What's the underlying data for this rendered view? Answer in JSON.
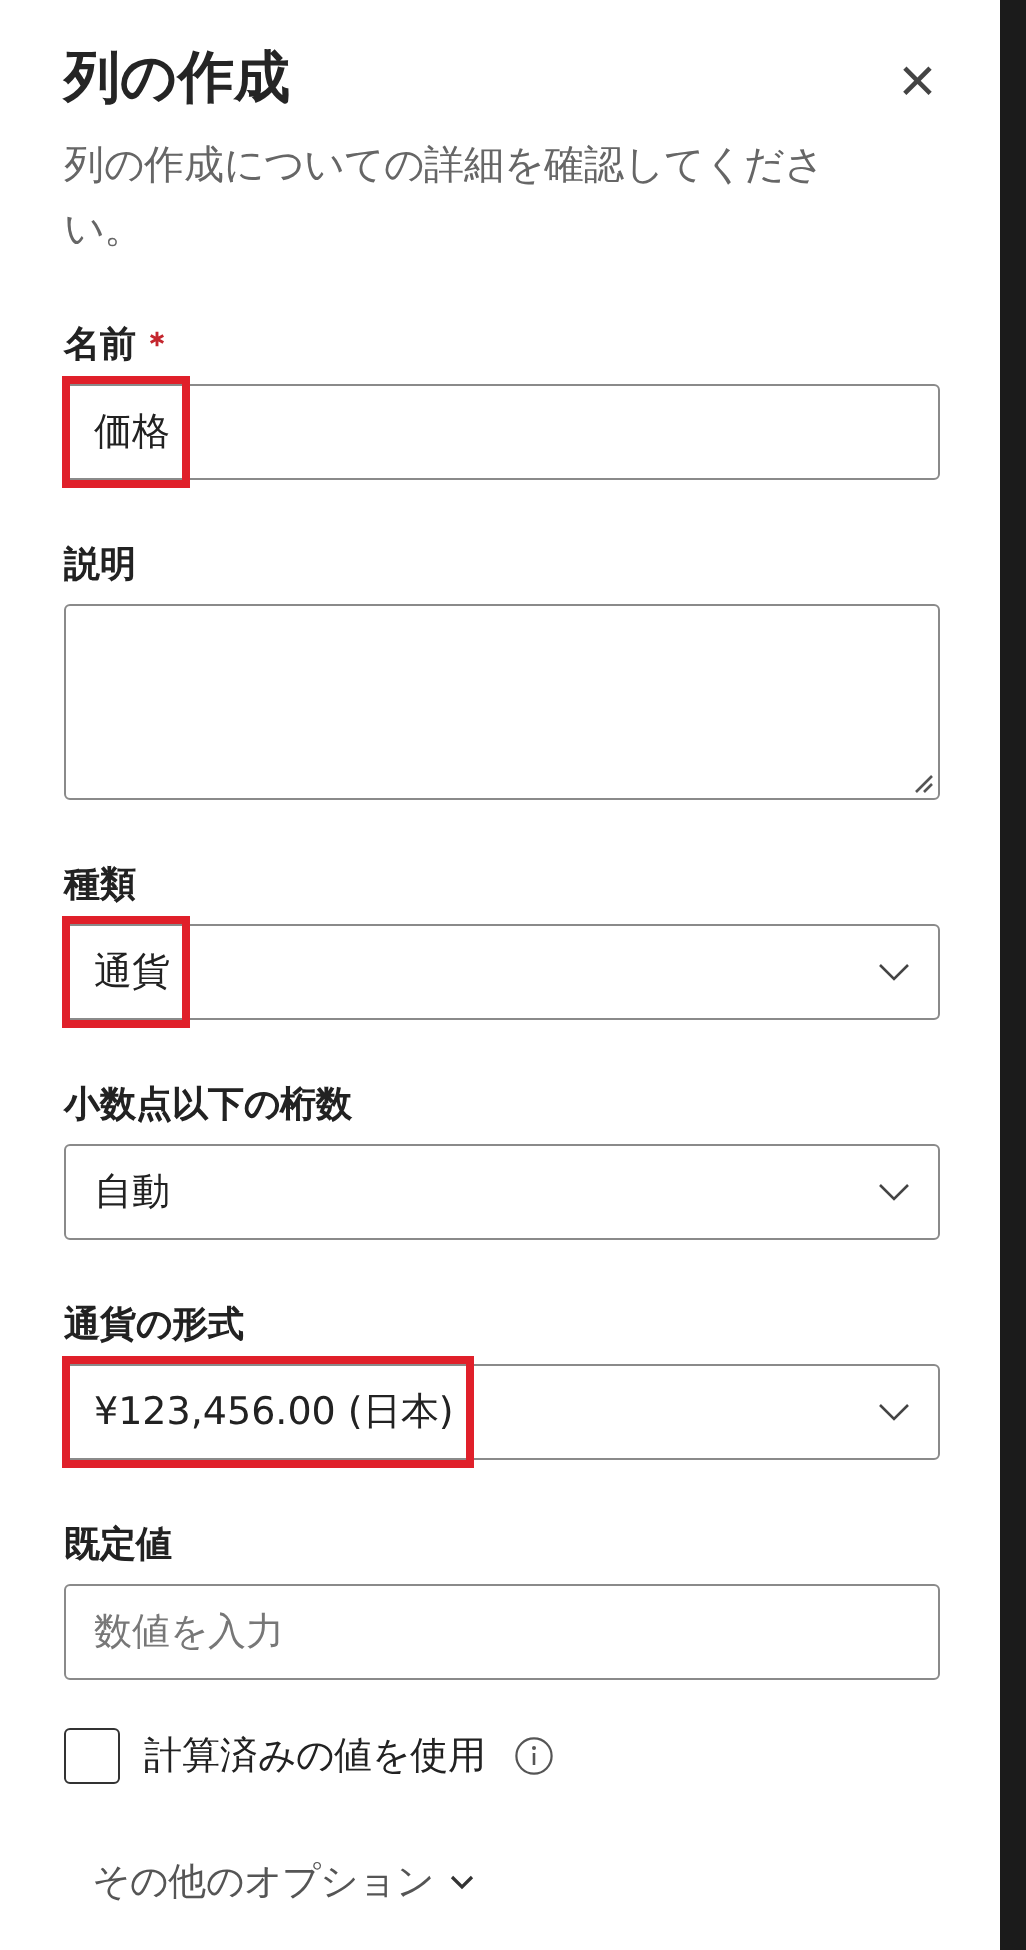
{
  "panel": {
    "title": "列の作成",
    "close": "×",
    "description": "列の作成についての詳細を確認してください。"
  },
  "fields": [
    {
      "kind": "text",
      "label": "名前",
      "required": true,
      "value": "価格",
      "highlighted": true
    },
    {
      "kind": "textarea",
      "label": "説明",
      "required": false,
      "highlighted": false
    },
    {
      "kind": "select",
      "label": "種類",
      "required": false,
      "value": "通貨",
      "highlighted": true
    },
    {
      "kind": "select",
      "label": "小数点以下の桁数",
      "required": false,
      "value": "自動",
      "highlighted": false
    },
    {
      "kind": "select",
      "label": "通貨の形式",
      "required": false,
      "value": "¥123,456.00 (日本)",
      "highlighted": true
    },
    {
      "kind": "text",
      "label": "既定値",
      "required": false,
      "placeholder": "数値を入力",
      "highlighted": false
    }
  ],
  "checkbox": {
    "label": "計算済みの値を使用",
    "checked": false
  },
  "more_options": {
    "label": "その他のオプション",
    "expanded": false
  }
}
